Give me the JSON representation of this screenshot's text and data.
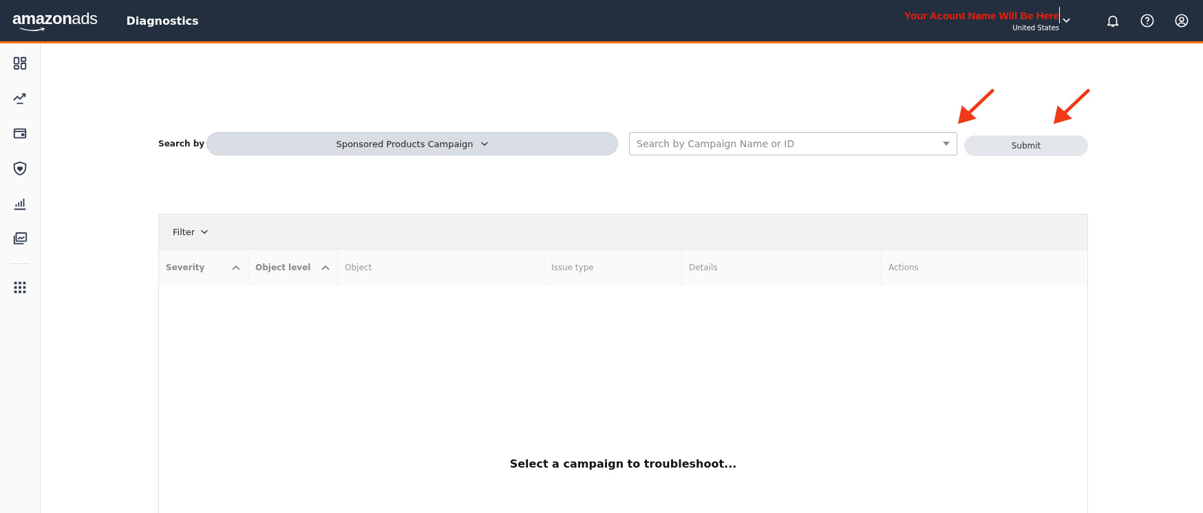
{
  "header": {
    "logo_brand": "amazon",
    "logo_product": "ads",
    "title": "Diagnostics",
    "account_name": "Your Acount Name Will Be Here",
    "country": "United States"
  },
  "sidebar": {
    "items": [
      {
        "kind": "dashboard"
      },
      {
        "kind": "trend"
      },
      {
        "kind": "wallet"
      },
      {
        "kind": "shield"
      },
      {
        "kind": "bars"
      },
      {
        "kind": "gallery"
      },
      {
        "kind": "apps"
      }
    ]
  },
  "search": {
    "label": "Search by",
    "type_value": "Sponsored Products Campaign",
    "placeholder": "Search by Campaign Name or ID",
    "submit": "Submit"
  },
  "table": {
    "filter": "Filter",
    "columns": [
      {
        "label": "Severity",
        "sortable": true
      },
      {
        "label": "Object level",
        "sortable": true
      },
      {
        "label": "Object",
        "sortable": false
      },
      {
        "label": "Issue type",
        "sortable": false
      },
      {
        "label": "Details",
        "sortable": false
      },
      {
        "label": "Actions",
        "sortable": false
      }
    ],
    "empty_message": "Select a campaign to troubleshoot..."
  }
}
